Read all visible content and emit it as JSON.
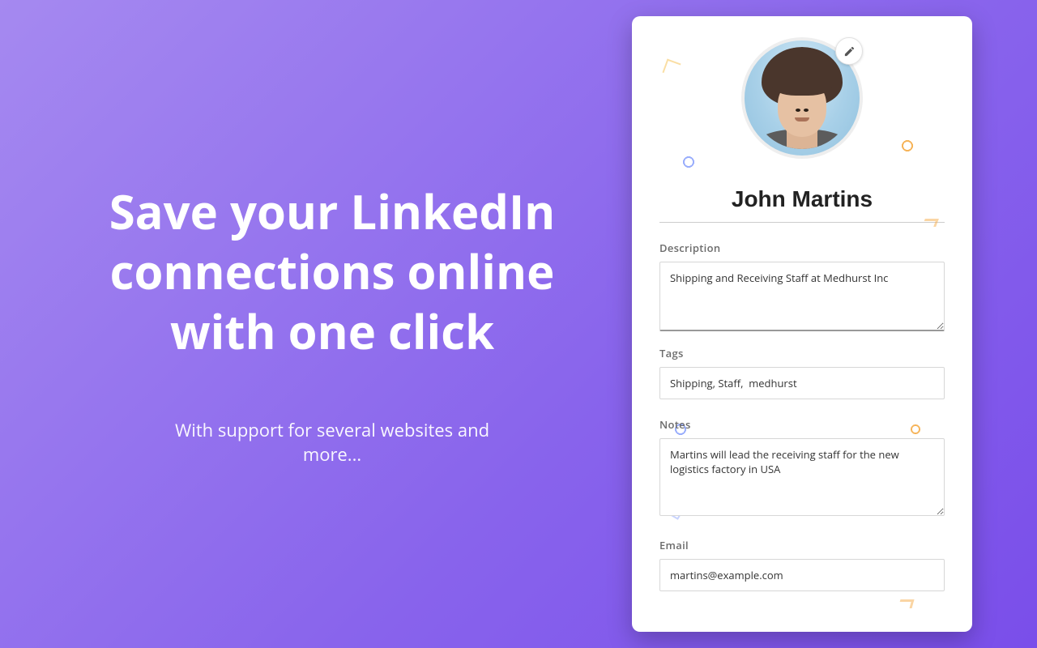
{
  "marketing": {
    "headline": "Save your LinkedIn connections online with one click",
    "subhead": "With support for several websites and more..."
  },
  "profile": {
    "name": "John Martins",
    "edit_icon": "pencil-icon",
    "fields": {
      "description": {
        "label": "Description",
        "value": "Shipping and Receiving Staff at Medhurst Inc"
      },
      "tags": {
        "label": "Tags",
        "value": "Shipping, Staff,  medhurst"
      },
      "notes": {
        "label": "Notes",
        "value": "Martins will lead the receiving staff for the new logistics factory in USA"
      },
      "email": {
        "label": "Email",
        "value": "martins@example.com"
      }
    }
  }
}
